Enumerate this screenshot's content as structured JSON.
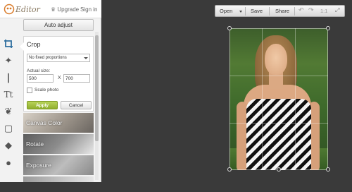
{
  "header": {
    "logo_text": "Editor",
    "upgrade_label": "Upgrade",
    "signin_label": "Sign in"
  },
  "tools": [
    {
      "name": "crop-tool",
      "icon": "⌗"
    },
    {
      "name": "magic-wand-tool",
      "icon": "✦"
    },
    {
      "name": "brush-tool",
      "icon": "❘"
    },
    {
      "name": "text-tool",
      "icon": "Tt"
    },
    {
      "name": "butterfly-tool",
      "icon": "❦"
    },
    {
      "name": "frame-tool",
      "icon": "▢"
    },
    {
      "name": "texture-tool",
      "icon": "◆"
    },
    {
      "name": "apple-tool",
      "icon": "●"
    }
  ],
  "panel": {
    "auto_adjust_label": "Auto adjust",
    "crop_title": "Crop",
    "proportions_value": "No fixed proportions",
    "actual_size_label": "Actual size:",
    "width_value": "500",
    "x_label": "X",
    "height_value": "700",
    "scale_label": "Scale photo",
    "apply_label": "Apply",
    "cancel_label": "Cancel",
    "tiles": [
      "Canvas Color",
      "Rotate",
      "Exposure"
    ]
  },
  "toolbar": {
    "open_label": "Open",
    "save_label": "Save",
    "share_label": "Share",
    "undo_icon": "↶",
    "redo_icon": "↷",
    "zoom_label": "1:1",
    "expand_icon": "⤢"
  },
  "colors": {
    "accent_apply": "#8fae2d",
    "active_tool": "#2f6f9f",
    "canvas_bg": "#3a3a3a"
  }
}
